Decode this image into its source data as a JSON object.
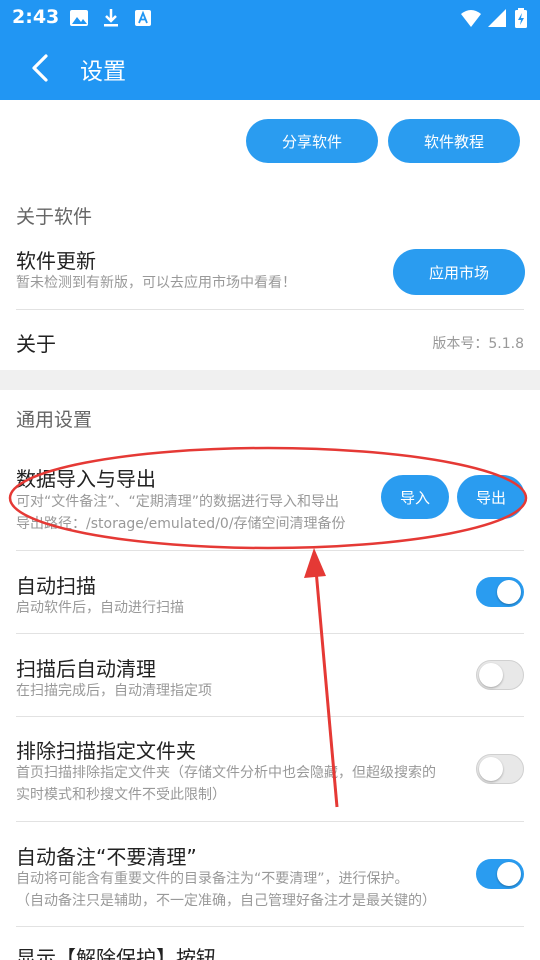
{
  "status_bar": {
    "time": "2:43"
  },
  "app_bar": {
    "title": "设置"
  },
  "top_buttons": {
    "share": "分享软件",
    "tutorial": "软件教程"
  },
  "about_section": {
    "title": "关于软件",
    "update": {
      "title": "软件更新",
      "subtitle": "暂未检测到有新版，可以去应用市场中看看！",
      "button": "应用市场"
    },
    "about": {
      "title": "关于",
      "version": "版本号：5.1.8"
    }
  },
  "general_section": {
    "title": "通用设置",
    "data_io": {
      "title": "数据导入与导出",
      "subtitle1": "可对“文件备注”、“定期清理”的数据进行导入和导出",
      "subtitle2": "导出路径：/storage/emulated/0/存储空间清理备份",
      "import": "导入",
      "export": "导出"
    },
    "items": [
      {
        "title": "自动扫描",
        "sub": [
          "启动软件后，自动进行扫描"
        ],
        "on": true
      },
      {
        "title": "扫描后自动清理",
        "sub": [
          "在扫描完成后，自动清理指定项"
        ],
        "on": false
      },
      {
        "title": "排除扫描指定文件夹",
        "sub": [
          "首页扫描排除指定文件夹（存储文件分析中也会隐藏，但超级搜索的",
          "实时模式和秒搜文件不受此限制）"
        ],
        "on": false
      },
      {
        "title": "自动备注“不要清理”",
        "sub": [
          "自动将可能含有重要文件的目录备注为“不要清理”，进行保护。",
          "（自动备注只是辅助，不一定准确，自己管理好备注才是最关键的）"
        ],
        "on": true
      },
      {
        "title": "显示【解除保护】按钮"
      }
    ]
  },
  "colors": {
    "primary": "#2196f3",
    "button": "#2a9cf0",
    "annotation": "#e53935"
  }
}
